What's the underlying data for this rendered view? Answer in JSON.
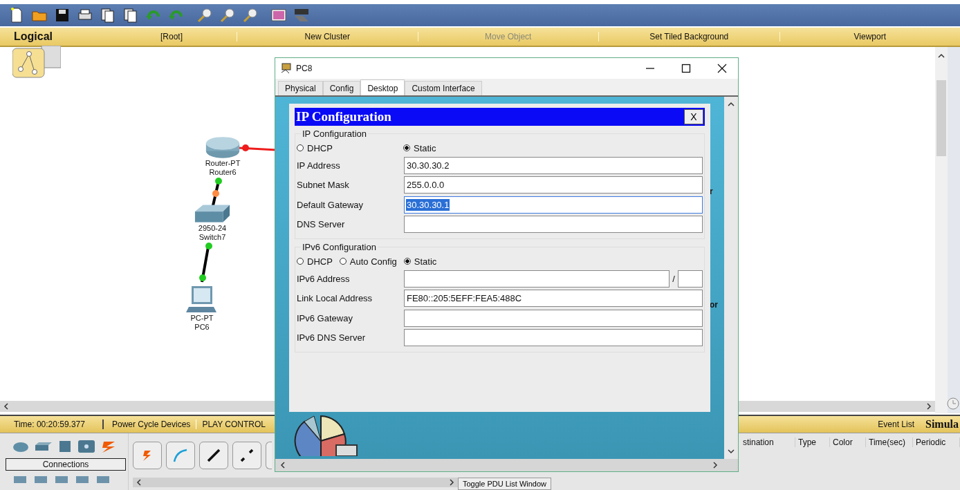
{
  "workspace_bar": {
    "mode_tab": "Logical",
    "items": [
      {
        "label": "[Root]",
        "disabled": false
      },
      {
        "label": "New Cluster",
        "disabled": false
      },
      {
        "label": "Move Object",
        "disabled": true
      },
      {
        "label": "Set Tiled Background",
        "disabled": false
      },
      {
        "label": "Viewport",
        "disabled": false
      }
    ]
  },
  "topology": {
    "devices": [
      {
        "kind": "router",
        "model": "Router-PT",
        "name": "Router6"
      },
      {
        "kind": "switch",
        "model": "2950-24",
        "name": "Switch7"
      },
      {
        "kind": "pc",
        "model": "PC-PT",
        "name": "PC6"
      }
    ],
    "link_lights": [
      {
        "color": "#ee1c1c"
      },
      {
        "color": "#22cc22"
      },
      {
        "color": "#ff8c42"
      },
      {
        "color": "#22cc22"
      },
      {
        "color": "#22cc22"
      }
    ]
  },
  "pc_window": {
    "title": "PC8",
    "tabs": [
      {
        "label": "Physical",
        "selected": false
      },
      {
        "label": "Config",
        "selected": false
      },
      {
        "label": "Desktop",
        "selected": true
      },
      {
        "label": "Custom Interface",
        "selected": false
      }
    ],
    "background_fragments": [
      "r",
      "or"
    ],
    "ip_dialog": {
      "title": "IP Configuration",
      "close": "X",
      "ipv4": {
        "legend": "IP Configuration",
        "modes": [
          {
            "label": "DHCP",
            "selected": false
          },
          {
            "label": "Static",
            "selected": true
          }
        ],
        "fields": [
          {
            "label": "IP Address",
            "value": "30.30.30.2",
            "highlighted": false
          },
          {
            "label": "Subnet Mask",
            "value": "255.0.0.0",
            "highlighted": false
          },
          {
            "label": "Default Gateway",
            "value": "30.30.30.1",
            "highlighted": true
          },
          {
            "label": "DNS Server",
            "highlighted": false
          }
        ]
      },
      "ipv6": {
        "legend": "IPv6 Configuration",
        "modes": [
          {
            "label": "DHCP",
            "selected": false
          },
          {
            "label": "Auto Config",
            "selected": false
          },
          {
            "label": "Static",
            "selected": true
          }
        ],
        "fields": [
          {
            "label": "IPv6 Address",
            "kind": "prefixed",
            "separator": "/"
          },
          {
            "label": "Link Local Address",
            "kind": "plain",
            "value": "FE80::205:5EFF:FEA5:488C"
          },
          {
            "label": "IPv6 Gateway",
            "kind": "plain"
          },
          {
            "label": "IPv6 DNS Server",
            "kind": "plain"
          }
        ]
      }
    }
  },
  "status_bar": {
    "time": "Time: 00:20:59.377",
    "power_cycle": "Power Cycle Devices",
    "play_controls": "PLAY CONTROL",
    "event_list": "Event List",
    "mode": "Simula"
  },
  "device_panel": {
    "category_label": "Connections"
  },
  "pdu_list": {
    "columns": [
      "stination",
      "Type",
      "Color",
      "Time(sec)",
      "Periodic"
    ],
    "toggle_button": "Toggle PDU List Window"
  }
}
